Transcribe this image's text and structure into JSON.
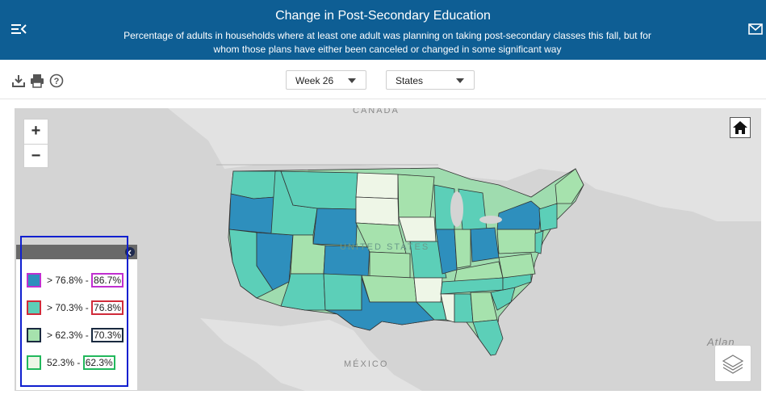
{
  "header": {
    "title": "Change in Post-Secondary Education",
    "subtitle": "Percentage of adults in households where at least one adult was planning on taking post-secondary classes this fall, but for whom those plans have either been canceled or changed in some significant way",
    "menu_icon": "menu-collapse-icon",
    "mail_icon": "mail-icon"
  },
  "toolbar": {
    "icons": [
      "download-icon",
      "print-icon",
      "help-icon"
    ],
    "week_select": "Week 26",
    "geography_select": "States"
  },
  "map": {
    "labels": {
      "canada": "CANADA",
      "usa": "UNITED STATES",
      "mexico": "MÉXICO",
      "ocean": "Atlan"
    },
    "controls": {
      "zoom_in": "+",
      "zoom_out": "−",
      "home_icon": "home-icon",
      "layers_icon": "layers-icon"
    }
  },
  "legend": {
    "items": [
      {
        "prefix": "> 76.8% - ",
        "upper": "86.7%",
        "fill": "#2e8fbd",
        "border": "#c02fd0"
      },
      {
        "prefix": "> 70.3% - ",
        "upper": "76.8%",
        "fill": "#5ccfb8",
        "border": "#d02b3a"
      },
      {
        "prefix": "> 62.3% - ",
        "upper": "70.3%",
        "fill": "#a6e2ad",
        "border": "#1a2a40"
      },
      {
        "prefix": "52.3% - ",
        "upper": "62.3%",
        "fill": "#eef6e7",
        "border": "#22b85c"
      }
    ]
  }
}
